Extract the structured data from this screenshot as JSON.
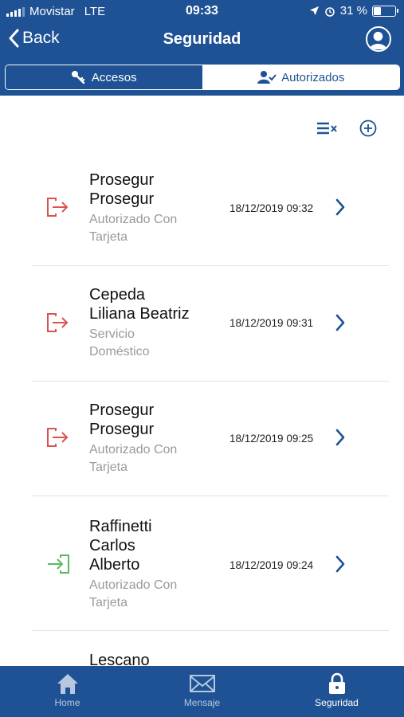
{
  "status_bar": {
    "carrier": "Movistar",
    "network": "LTE",
    "time": "09:33",
    "battery": "31 %",
    "battery_level": 0.31
  },
  "nav": {
    "back_label": "Back",
    "title": "Seguridad"
  },
  "segmented": {
    "tabs": [
      {
        "label": "Accesos",
        "active": true
      },
      {
        "label": "Autorizados",
        "active": false
      }
    ]
  },
  "toolbar": {
    "icons": [
      "clear-list-icon",
      "add-circle-icon"
    ]
  },
  "entries": [
    {
      "name_line1": "Prosegur",
      "name_line2": "Prosegur",
      "name_line3": "",
      "sub_line1": "Autorizado Con",
      "sub_line2": "Tarjeta",
      "datetime": "18/12/2019 09:32",
      "direction": "exit"
    },
    {
      "name_line1": "Cepeda",
      "name_line2": "Liliana Beatriz",
      "name_line3": "",
      "sub_line1": "Servicio",
      "sub_line2": "Doméstico",
      "datetime": "18/12/2019 09:31",
      "direction": "exit"
    },
    {
      "name_line1": "Prosegur",
      "name_line2": "Prosegur",
      "name_line3": "",
      "sub_line1": "Autorizado Con",
      "sub_line2": "Tarjeta",
      "datetime": "18/12/2019 09:25",
      "direction": "exit"
    },
    {
      "name_line1": "Raffinetti",
      "name_line2": "Carlos",
      "name_line3": "Alberto",
      "sub_line1": "Autorizado Con",
      "sub_line2": "Tarjeta",
      "datetime": "18/12/2019 09:24",
      "direction": "enter"
    },
    {
      "name_line1": "Lescano",
      "name_line2": "",
      "name_line3": "",
      "sub_line1": "",
      "sub_line2": "",
      "datetime": "",
      "direction": ""
    }
  ],
  "tabbar": {
    "items": [
      {
        "label": "Home",
        "icon": "home-icon"
      },
      {
        "label": "Mensaje",
        "icon": "envelope-icon"
      },
      {
        "label": "Seguridad",
        "icon": "lock-icon",
        "active": true
      }
    ]
  },
  "colors": {
    "brand": "#1e5294",
    "exit": "#d9534f",
    "enter": "#5cb85c",
    "chevron": "#1e5294"
  }
}
